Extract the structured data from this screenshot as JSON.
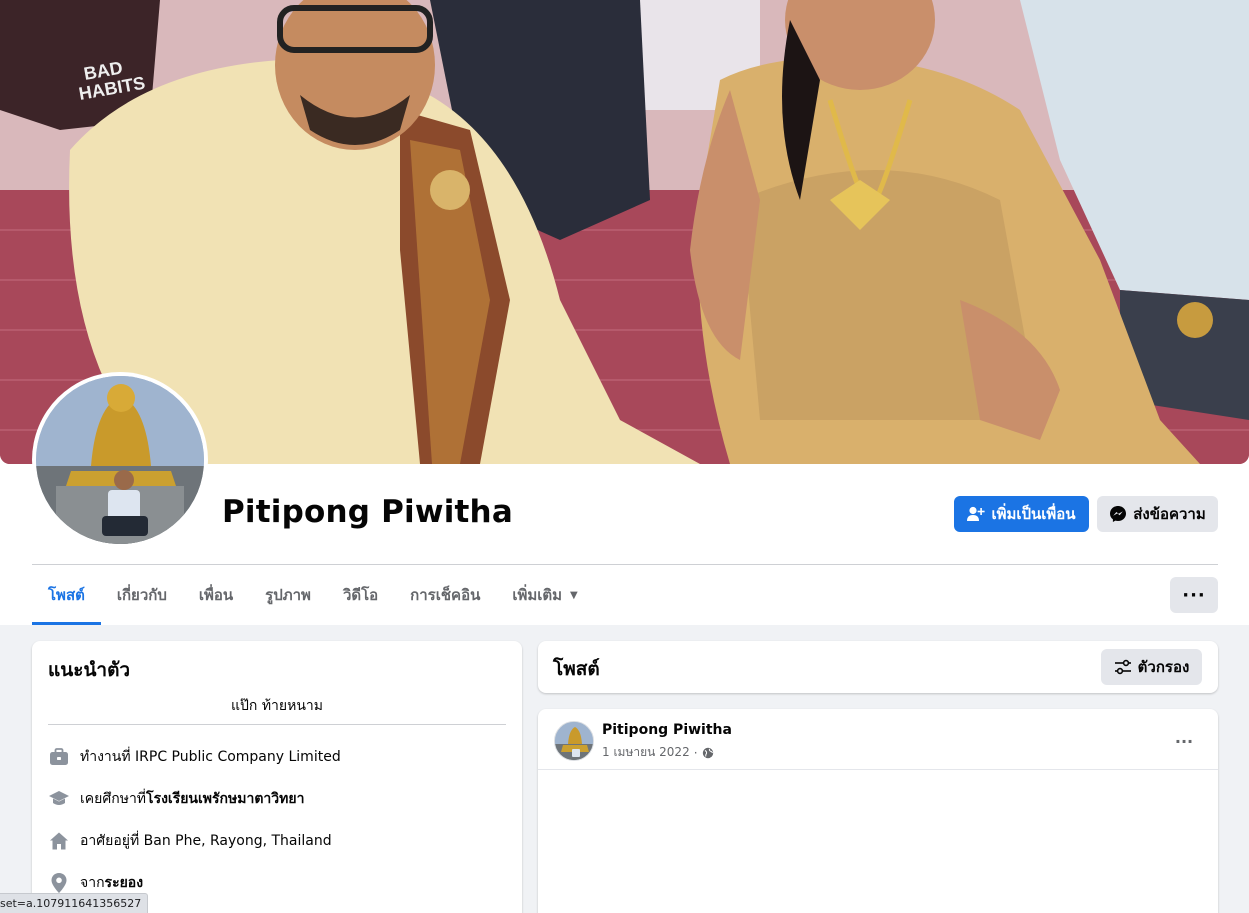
{
  "profile": {
    "name": "Pitipong Piwitha"
  },
  "actions": {
    "add_friend": "เพิ่มเป็นเพื่อน",
    "message": "ส่งข้อความ",
    "more": "···"
  },
  "tabs": [
    {
      "label": "โพสต์",
      "active": true
    },
    {
      "label": "เกี่ยวกับ",
      "active": false
    },
    {
      "label": "เพื่อน",
      "active": false
    },
    {
      "label": "รูปภาพ",
      "active": false
    },
    {
      "label": "วิดีโอ",
      "active": false
    },
    {
      "label": "การเช็คอิน",
      "active": false
    },
    {
      "label": "เพิ่มเติม",
      "active": false
    }
  ],
  "intro": {
    "title": "แนะนำตัว",
    "bio": "แป๊ก ท้ายหนาม",
    "items": [
      {
        "icon": "briefcase-icon",
        "prefix": "ทำงานที่ IRPC Public Company Limited",
        "bold": ""
      },
      {
        "icon": "graduation-cap-icon",
        "prefix": "เคยศึกษาที่ ",
        "bold": "โรงเรียนเพรักษมาตาวิทยา"
      },
      {
        "icon": "home-icon",
        "prefix": "อาศัยอยู่ที่ Ban Phe, Rayong, Thailand",
        "bold": ""
      },
      {
        "icon": "location-pin-icon",
        "prefix": "จาก ",
        "bold": "ระยอง"
      }
    ]
  },
  "posts": {
    "title": "โพสต์",
    "filter_label": "ตัวกรอง",
    "items": [
      {
        "author": "Pitipong Piwitha",
        "date": "1 เมษายน 2022",
        "separator": "·",
        "privacy_icon": "globe-icon"
      }
    ]
  },
  "status_bar": {
    "url": "set=a.107911641356527"
  },
  "colors": {
    "accent": "#1b74e4",
    "page_bg": "#f0f2f5",
    "secondary_btn": "#e4e6eb",
    "muted_text": "#65676b"
  }
}
